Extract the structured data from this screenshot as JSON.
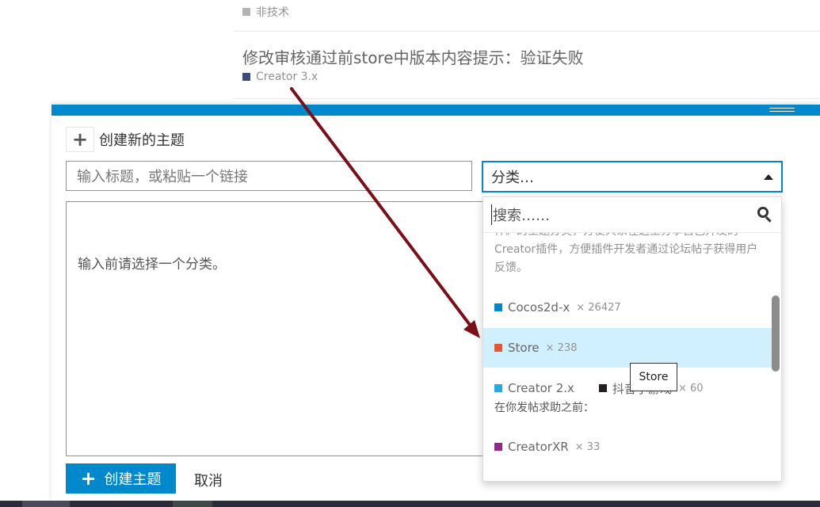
{
  "background_list": {
    "topic_prev": {
      "category": "非技术",
      "category_color": "#b3b3b3"
    },
    "topic_current": {
      "title": "修改审核通过前store中版本内容提示：验证失败",
      "category": "Creator 3.x",
      "category_color": "#3a4c7a"
    }
  },
  "composer": {
    "action_label": "创建新的主题",
    "title_placeholder": "输入标题，或粘贴一个链接",
    "category_select_label": "分类…",
    "editor_placeholder": "输入前请选择一个分类。",
    "submit_label": "创建主题",
    "cancel_label": "取消",
    "accent_color": "#0088cc"
  },
  "category_dropdown": {
    "search_placeholder": "搜索……",
    "partial_description": "件》的主题分类，方便大家在这里分享自己开发的Creator插件，方便插件开发者通过论坛帖子获得用户反馈。",
    "items": [
      {
        "name": "Cocos2d-x",
        "count": "× 26427",
        "color": "#0088cc"
      },
      {
        "name": "Store",
        "count": "× 238",
        "color": "#e45735",
        "selected": true
      },
      {
        "name": "Creator 2.x",
        "count": "",
        "color": "#25aae2",
        "extra_name": "抖音小游戏",
        "extra_count": "× 60",
        "extra_color": "#231f20",
        "subtext": "在你发帖求助之前："
      },
      {
        "name": "CreatorXR",
        "count": "× 33",
        "color": "#92278f"
      }
    ]
  },
  "tooltip": {
    "text": "Store"
  }
}
